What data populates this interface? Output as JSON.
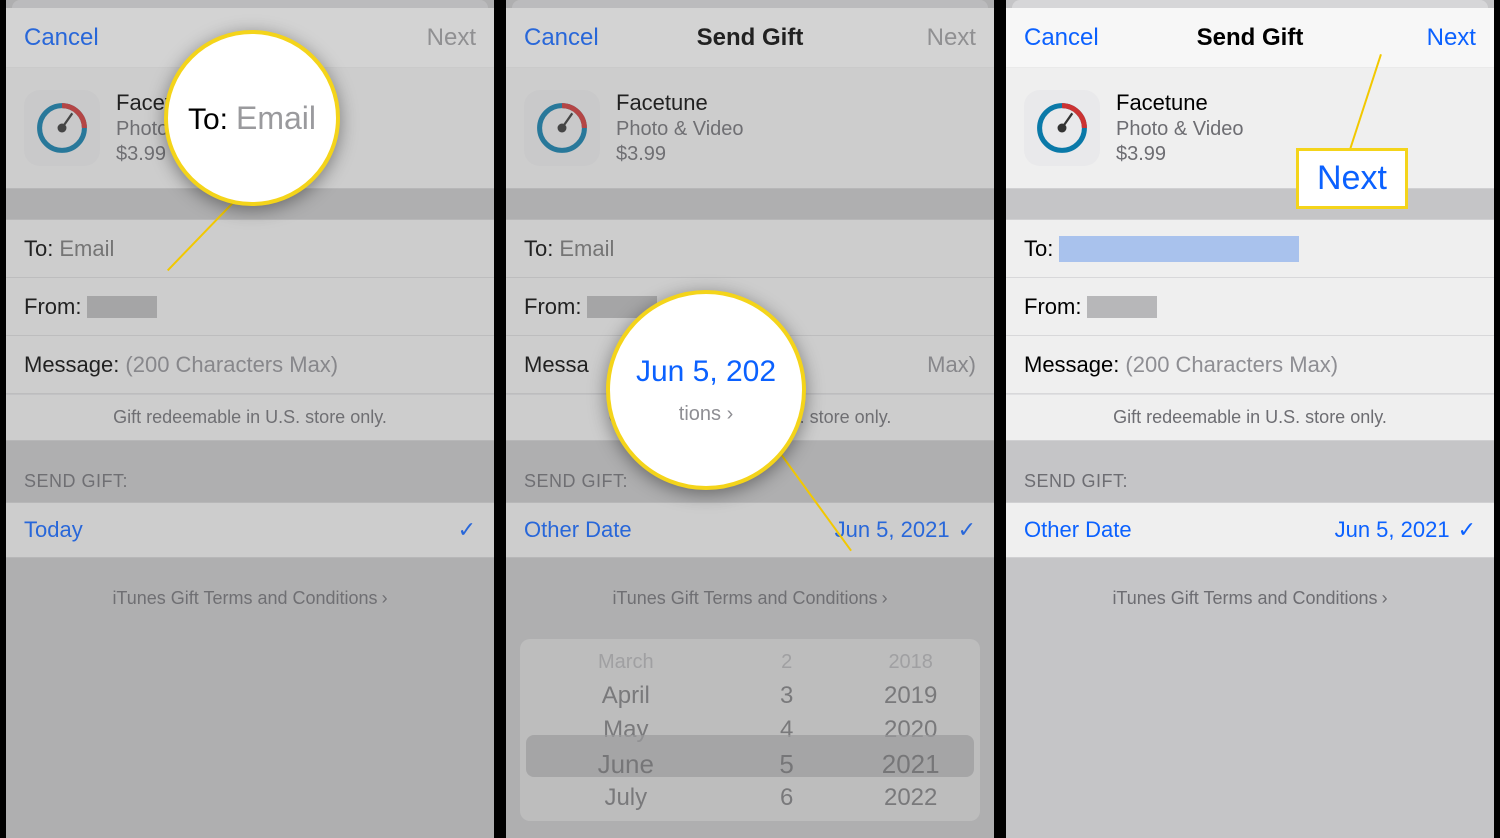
{
  "header": {
    "cancel": "Cancel",
    "title": "Send Gift",
    "next": "Next",
    "next_disabled": "Next"
  },
  "app": {
    "name": "Facetune",
    "name_trunc": "Facetu",
    "category": "Photo & Video",
    "category_trunc": "Photo &",
    "price": "$3.99"
  },
  "fields": {
    "to_label": "To:",
    "to_placeholder": "Email",
    "from_label": "From:",
    "message_label": "Message:",
    "message_placeholder": "(200 Characters Max)",
    "redeem_note": "Gift redeemable in U.S. store only."
  },
  "send": {
    "heading": "SEND GIFT:",
    "today": "Today",
    "other_date": "Other Date",
    "date_value": "Jun 5, 2021"
  },
  "terms": {
    "label": "iTunes Gift Terms and Conditions"
  },
  "picker": {
    "months": [
      "March",
      "April",
      "May",
      "June",
      "July"
    ],
    "days": [
      "2",
      "3",
      "4",
      "5",
      "6"
    ],
    "years": [
      "2018",
      "2019",
      "2020",
      "2021",
      "2022"
    ],
    "selected_index": 3
  },
  "mag1": {
    "to": "To:",
    "email": "Email"
  },
  "mag2": {
    "date": "Jun 5, 202",
    "sub": "tions ›"
  },
  "hl_next": "Next",
  "icons": {
    "check": "✓",
    "chevron": "›"
  },
  "chart_data": null
}
